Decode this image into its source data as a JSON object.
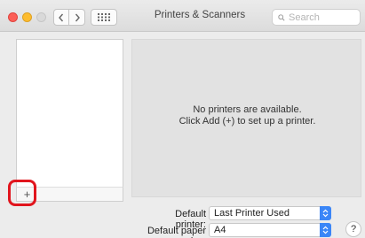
{
  "window": {
    "title": "Printers & Scanners"
  },
  "toolbar": {
    "search_placeholder": "Search",
    "back_icon": "chevron-left-icon",
    "forward_icon": "chevron-right-icon",
    "grid_icon": "grid-icon"
  },
  "printer_list": {
    "items": [],
    "add_label": "+"
  },
  "detail": {
    "message_line1": "No printers are available.",
    "message_line2": "Click Add (+) to set up a printer."
  },
  "form": {
    "default_printer_label": "Default printer:",
    "default_printer_value": "Last Printer Used",
    "paper_size_label": "Default paper size:",
    "paper_size_value": "A4"
  },
  "help": {
    "label": "?"
  },
  "colors": {
    "highlight": "#e1151d",
    "stepper": "#3b86f7",
    "close": "#fc5f57",
    "minimize": "#fdbc2e"
  }
}
